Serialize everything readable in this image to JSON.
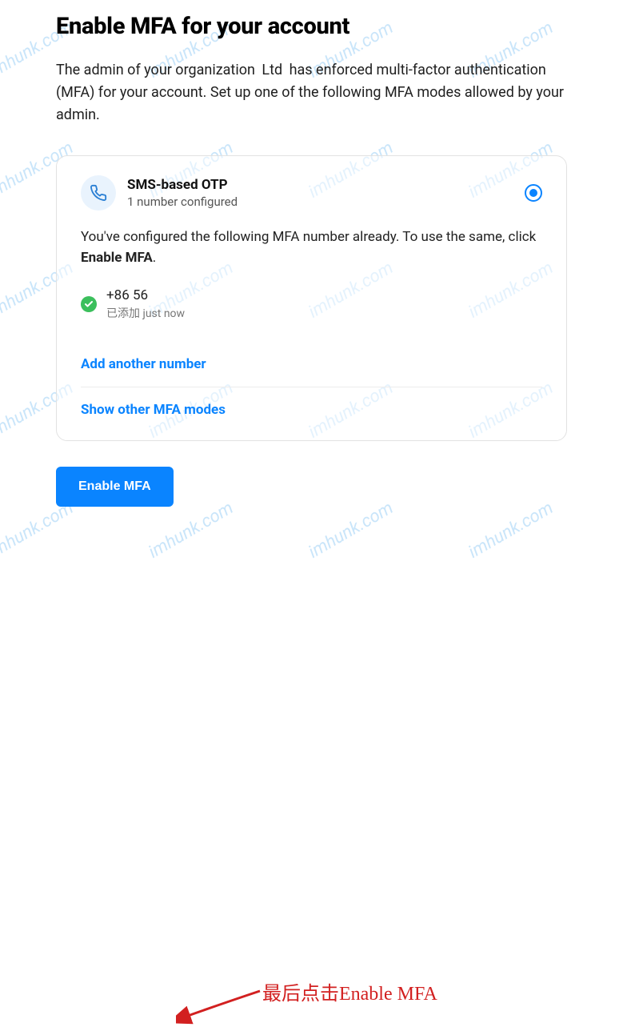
{
  "page": {
    "title": "Enable MFA for your account",
    "description_prefix": "The admin of your organization ",
    "org_name_masked": "       Ltd",
    "description_suffix": " has enforced multi-factor authentication (MFA) for your account. Set up one of the following MFA modes allowed by your admin."
  },
  "card": {
    "mode_title": "SMS-based OTP",
    "mode_subtitle": "1 number configured",
    "selected": true,
    "info_prefix": "You've configured the following MFA number already. To use the same, click ",
    "info_bold": "Enable MFA",
    "info_suffix": ".",
    "number": {
      "masked_value": "+86            56",
      "status_text": "已添加 just now"
    },
    "add_link": "Add another number",
    "show_other_link": "Show other MFA modes"
  },
  "actions": {
    "primary": "Enable MFA"
  },
  "annotation": {
    "text": "最后点击Enable MFA"
  },
  "watermark": "imhunk.com"
}
